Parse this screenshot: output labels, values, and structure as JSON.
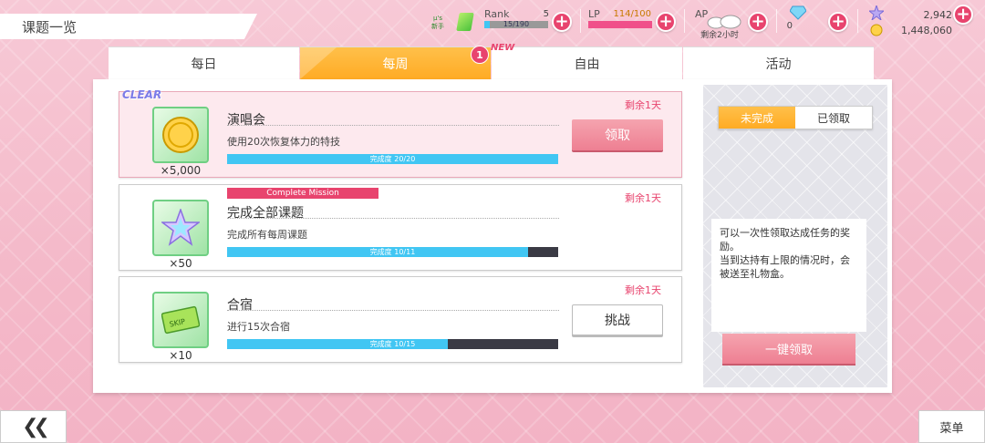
{
  "header": {
    "title": "课题一览",
    "school_badge": "μ's\n新手",
    "rank": {
      "label": "Rank",
      "value": "5",
      "progress_text": "15/190",
      "progress": 0.08
    },
    "lp": {
      "label": "LP",
      "value": "114/100",
      "progress": 1.0
    },
    "ap": {
      "label": "AP",
      "subtext": "剩余2小时"
    },
    "gems": {
      "value": "0"
    },
    "currency": {
      "stars": "2,942",
      "gold": "1,448,060"
    }
  },
  "tabs": [
    {
      "label": "每日",
      "active": false
    },
    {
      "label": "每周",
      "active": true
    },
    {
      "label": "自由",
      "active": false
    },
    {
      "label": "活动",
      "active": false
    }
  ],
  "weekly_badge": {
    "count": "1",
    "new_label": "NEW"
  },
  "missions": [
    {
      "title": "演唱会",
      "desc": "使用20次恢复体力的特技",
      "remain": "剩余1天",
      "progress_text": "完成度  20/20",
      "progress": 1.0,
      "reward_qty": "×5,000",
      "reward_icon": "gold-coin-icon",
      "button": "领取",
      "tag": "CLEAR"
    },
    {
      "title": "完成全部课题",
      "desc": "完成所有每周课题",
      "remain": "剩余1天",
      "progress_text": "完成度  10/11",
      "progress": 0.909,
      "reward_qty": "×50",
      "reward_icon": "star-gem-icon",
      "tag": "Complete Mission"
    },
    {
      "title": "合宿",
      "desc": "进行15次合宿",
      "remain": "剩余1天",
      "progress_text": "完成度  10/15",
      "progress": 0.667,
      "reward_qty": "×10",
      "reward_icon": "skip-ticket-icon",
      "button": "挑战"
    }
  ],
  "side": {
    "toggle_incomplete": "未完成",
    "toggle_claimed": "已领取",
    "info": "可以一次性领取达成任务的奖励。\n当到达持有上限的情况时，会被送至礼物盒。",
    "claim_all": "一键领取"
  },
  "footer": {
    "back": "❮❮",
    "menu": "菜单"
  }
}
